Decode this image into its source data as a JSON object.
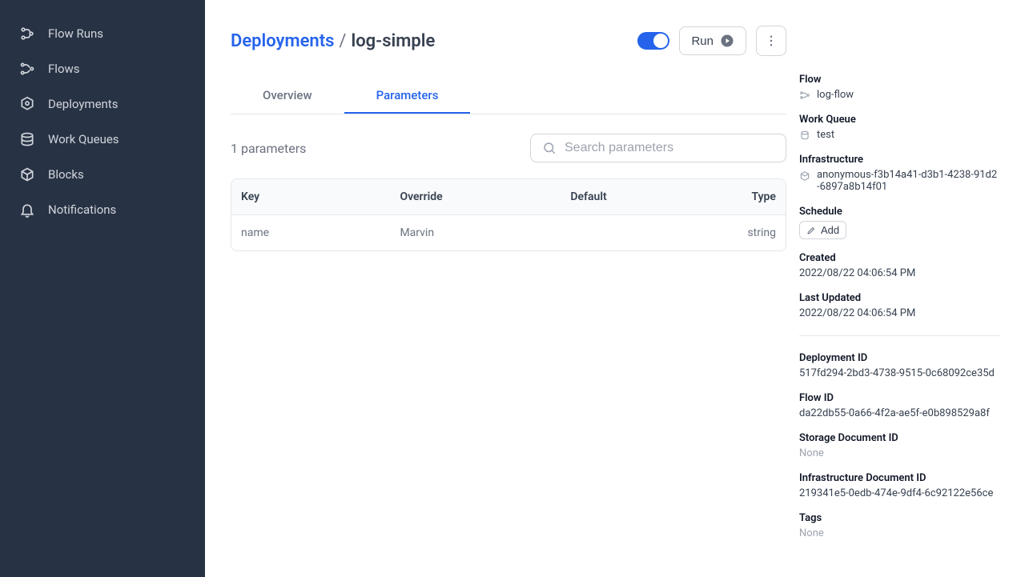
{
  "sidebar": {
    "items": [
      {
        "label": "Flow Runs"
      },
      {
        "label": "Flows"
      },
      {
        "label": "Deployments"
      },
      {
        "label": "Work Queues"
      },
      {
        "label": "Blocks"
      },
      {
        "label": "Notifications"
      }
    ]
  },
  "breadcrumb": {
    "parent": "Deployments",
    "current": "log-simple"
  },
  "actions": {
    "run_label": "Run"
  },
  "tabs": [
    {
      "label": "Overview",
      "active": false
    },
    {
      "label": "Parameters",
      "active": true
    }
  ],
  "filter": {
    "count_label": "1 parameters",
    "search_placeholder": "Search parameters"
  },
  "table": {
    "headers": {
      "key": "Key",
      "override": "Override",
      "default": "Default",
      "type": "Type"
    },
    "rows": [
      {
        "key": "name",
        "override": "Marvin",
        "default": "",
        "type": "string"
      }
    ]
  },
  "details": {
    "flow_label": "Flow",
    "flow_value": "log-flow",
    "work_queue_label": "Work Queue",
    "work_queue_value": "test",
    "infrastructure_label": "Infrastructure",
    "infrastructure_value": "anonymous-f3b14a41-d3b1-4238-91d2-6897a8b14f01",
    "schedule_label": "Schedule",
    "schedule_add": "Add",
    "created_label": "Created",
    "created_value": "2022/08/22 04:06:54 PM",
    "updated_label": "Last Updated",
    "updated_value": "2022/08/22 04:06:54 PM",
    "deployment_id_label": "Deployment ID",
    "deployment_id_value": "517fd294-2bd3-4738-9515-0c68092ce35d",
    "flow_id_label": "Flow ID",
    "flow_id_value": "da22db55-0a66-4f2a-ae5f-e0b898529a8f",
    "storage_doc_label": "Storage Document ID",
    "storage_doc_value": "None",
    "infra_doc_label": "Infrastructure Document ID",
    "infra_doc_value": "219341e5-0edb-474e-9df4-6c92122e56ce",
    "tags_label": "Tags",
    "tags_value": "None"
  }
}
